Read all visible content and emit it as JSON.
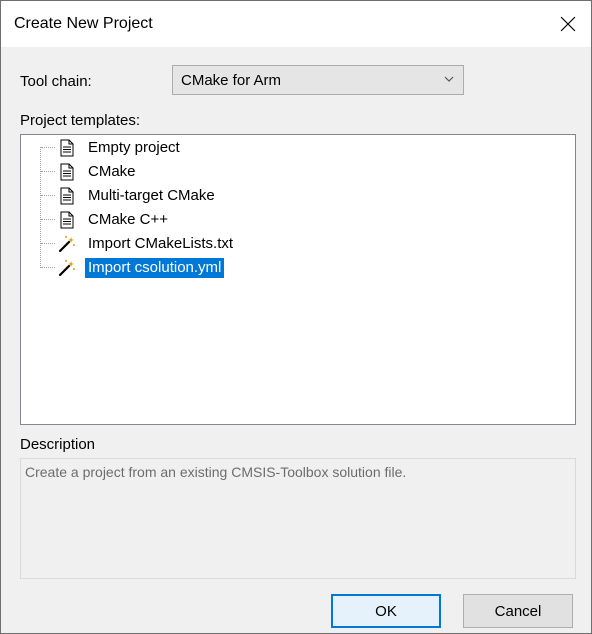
{
  "window": {
    "title": "Create New Project"
  },
  "toolchain": {
    "label": "Tool chain:",
    "value": "CMake for Arm"
  },
  "templates": {
    "label": "Project templates:",
    "items": [
      {
        "label": "Empty project",
        "icon": "document-icon"
      },
      {
        "label": "CMake",
        "icon": "document-icon"
      },
      {
        "label": "Multi-target CMake",
        "icon": "document-icon"
      },
      {
        "label": "CMake C++",
        "icon": "document-icon"
      },
      {
        "label": "Import CMakeLists.txt",
        "icon": "magic-wand-icon"
      },
      {
        "label": "Import csolution.yml",
        "icon": "magic-wand-icon"
      }
    ],
    "selected_index": 5
  },
  "description": {
    "label": "Description",
    "text": "Create a project from an existing CMSIS-Toolbox solution file."
  },
  "buttons": {
    "ok": "OK",
    "cancel": "Cancel"
  },
  "colors": {
    "selection": "#0078d7",
    "dialog_bg": "#f0f0f0",
    "accent": "#0078d7"
  }
}
